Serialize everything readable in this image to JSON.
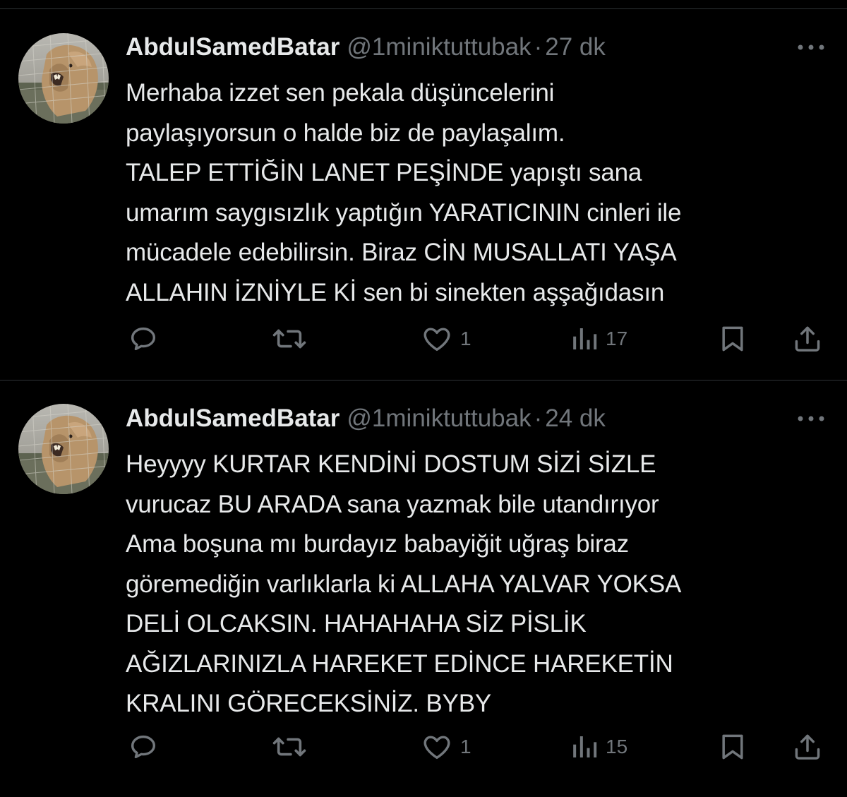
{
  "tweets": [
    {
      "display_name": "AbdulSamedBatar",
      "handle": "@1miniktuttubak",
      "separator": "·",
      "time": "27 dk",
      "lines": [
        "Merhaba izzet sen pekala düşüncelerini",
        "paylaşıyorsun o halde biz de paylaşalım.",
        "TALEP ETTİĞİN LANET PEŞİNDE yapıştı sana",
        "umarım saygısızlık yaptığın YARATICININ cinleri ile",
        "mücadele edebilirsin. Biraz CİN MUSALLATI YAŞA",
        "ALLAHIN İZNİYLE Kİ sen bi sinekten aşşağıdasın"
      ],
      "likes": "1",
      "views": "17"
    },
    {
      "display_name": "AbdulSamedBatar",
      "handle": "@1miniktuttubak",
      "separator": "·",
      "time": "24 dk",
      "lines": [
        "Heyyyy KURTAR KENDİNİ DOSTUM SİZİ SİZLE",
        "vurucaz BU ARADA sana yazmak bile utandırıyor",
        "Ama boşuna mı burdayız babayiğit uğraş biraz",
        "göremediğin varlıklarla ki ALLAHA YALVAR YOKSA",
        "DELİ OLCAKSIN. HAHAHAHA SİZ PİSLİK",
        "AĞIZLARINIZLA HAREKET EDİNCE HAREKETİN",
        "KRALINI GÖRECEKSİNİZ. BYBY"
      ],
      "likes": "1",
      "views": "15"
    }
  ],
  "icons": {
    "avatar": "lion-avatar",
    "more": "more-dots-icon",
    "reply": "reply-icon",
    "retweet": "retweet-icon",
    "like": "heart-icon",
    "views": "views-chart-icon",
    "bookmark": "bookmark-icon",
    "share": "share-icon"
  },
  "colors": {
    "background": "#000000",
    "text": "#e7e9ea",
    "secondary": "#71767b",
    "divider": "#2f3336"
  }
}
